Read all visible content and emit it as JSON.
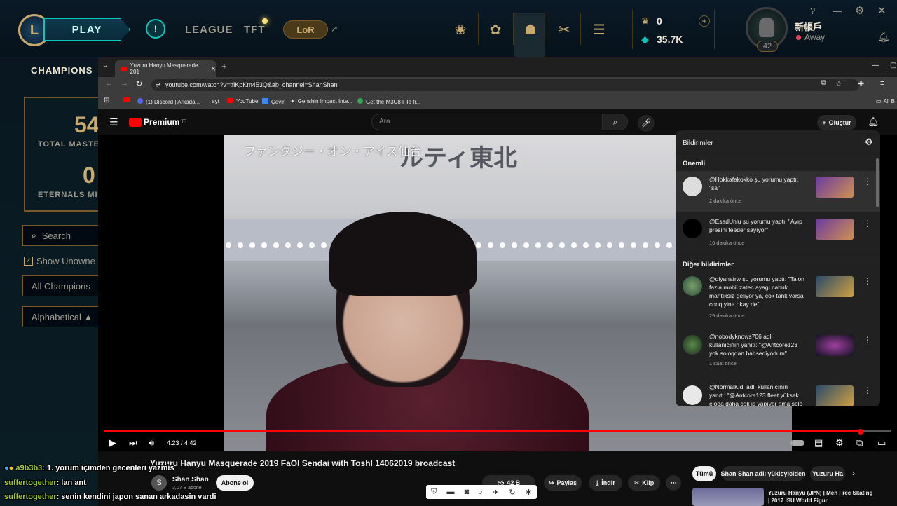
{
  "lol": {
    "logo_letter": "L",
    "play_label": "PLAY",
    "nav": [
      "LEAGUE",
      "TFT"
    ],
    "lor_label": "LoR",
    "currency": {
      "rp": "0",
      "be": "35.7K"
    },
    "profile": {
      "name": "新帳戶",
      "status": "Away",
      "level": "42"
    },
    "left": {
      "tab": "CHAMPIONS",
      "mastery_total": "54",
      "mastery_label": "TOTAL MASTE",
      "eternals_num": "0",
      "eternals_label": "ETERNALS MI",
      "search_placeholder": "Search",
      "show_unowned": "Show Unowne",
      "filter": "All Champions",
      "sort": "Alphabetical ▲"
    }
  },
  "browser": {
    "tab_title": "Yuzuru Hanyu Masquerade 201",
    "url": "youtube.com/watch?v=tflKpKm453Q&ab_channel=ShanShan",
    "bookmarks": [
      "(1) Discord | Arkada...",
      "ayt",
      "YouTube",
      "Çevir",
      "Genshin Impact Inte...",
      "Get the M3U8 File fr..."
    ],
    "all_bookmarks": "All B"
  },
  "youtube": {
    "brand": "Premium",
    "brand_sup": "TR",
    "search_placeholder": "Ara",
    "create_label": "Oluştur",
    "video_caption": "ファンタジー・オン・アイス仙台",
    "time": "4:23 / 4:42",
    "progress": 0.96,
    "title": "Yuzuru Hanyu Masquerade 2019 FaOI Sendai with ToshI 14062019 broadcast",
    "channel": {
      "initial": "S",
      "name": "Shan Shan",
      "subs": "3,07 B abone",
      "subscribe": "Abone ol"
    },
    "actions": {
      "likes": "42 B",
      "share": "Paylaş",
      "download": "İndir",
      "clip": "Klip"
    },
    "chips": [
      "Tümü",
      "Shan Shan adlı yükleyiciden",
      "Yuzuru Ha"
    ],
    "side_video": "Yuzuru Hanyu (JPN) | Men Free Skating | 2017 ISU World Figur",
    "notifications": {
      "title": "Bildirimler",
      "important_label": "Önemli",
      "other_label": "Diğer bildirimler",
      "items": [
        {
          "text": "@Hokkafakokko şu yorumu yaptı: \"sa\"",
          "time": "2 dakika önce"
        },
        {
          "text": "@EsadUnlu şu yorumu yaptı: \"Ayıp presini feeder sayıyor\"",
          "time": "16 dakika önce"
        },
        {
          "text": "@qiyanafrw şu yorumu yaptı: \"Talon fazla mobil zaten ayagı cabuk mantıksız geliyor ya, cok tank varsa conq yine okay de\"",
          "time": "25 dakika önce"
        },
        {
          "text": "@nobodyknows706 adlı kullanıcının yanıtı: \"@Antcore123 yok soloqdan bahsediyodum\"",
          "time": "1 saat önce"
        },
        {
          "text": "@NormalKid. adlı kullanıcının yanıtı: \"@Antcore123 fleet yüksek eloda daha çok iş yapıyor ama solo carry",
          "time": ""
        }
      ]
    }
  },
  "chat": [
    {
      "user": "a9b3b3",
      "msg": ": 1. yorum içimden gecenleri yazmis"
    },
    {
      "user": "suffertogether",
      "msg": ": lan ant"
    },
    {
      "user": "suffertogether",
      "msg": ": senin kendini japon sanan arkadasin vardi"
    }
  ],
  "colors": {
    "lol_gold": "#c8aa6e",
    "yt_red": "#ff0000",
    "hextech_teal": "#0ac8b9"
  }
}
